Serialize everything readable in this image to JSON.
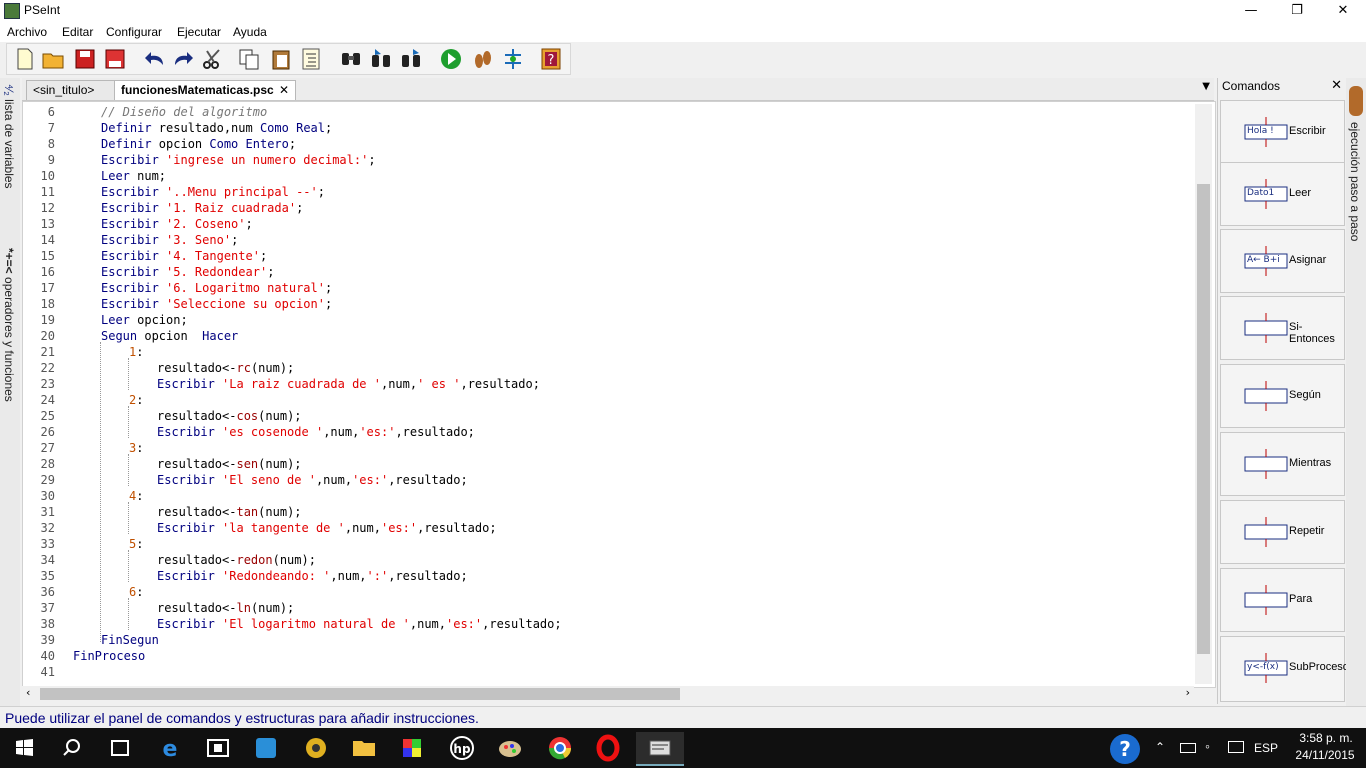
{
  "window": {
    "title": "PSeInt",
    "controls": [
      "minimize-icon",
      "maximize-icon",
      "close-icon"
    ]
  },
  "menu": [
    "Archivo",
    "Editar",
    "Configurar",
    "Ejecutar",
    "Ayuda"
  ],
  "toolbar": [
    "new-file-icon",
    "open-file-icon",
    "save-icon",
    "save-as-icon",
    "undo-icon",
    "redo-icon",
    "cut-icon",
    "copy-icon",
    "paste-icon",
    "indent-icon",
    "search-icon",
    "search-next-icon",
    "replace-icon",
    "run-icon",
    "step-icon",
    "flowchart-icon",
    "help-icon"
  ],
  "tabs": [
    {
      "label": "<sin_titulo>",
      "active": false
    },
    {
      "label": "funcionesMatematicas.psc",
      "active": true
    }
  ],
  "tab_close": "✕",
  "left_sidebar": {
    "variables_label": "lista de variables",
    "operators_label": "operadores y funciones"
  },
  "code_lines": [
    {
      "n": "6",
      "text": "// Diseño del algoritmo"
    },
    {
      "n": "7",
      "text": "Definir resultado,num Como Real;"
    },
    {
      "n": "8",
      "text": "Definir opcion Como Entero;"
    },
    {
      "n": "9",
      "text": "Escribir 'ingrese un numero decimal:';"
    },
    {
      "n": "10",
      "text": "Leer num;"
    },
    {
      "n": "11",
      "text": "Escribir '..Menu principal --';"
    },
    {
      "n": "12",
      "text": "Escribir '1. Raiz cuadrada';"
    },
    {
      "n": "13",
      "text": "Escribir '2. Coseno';"
    },
    {
      "n": "14",
      "text": "Escribir '3. Seno';"
    },
    {
      "n": "15",
      "text": "Escribir '4. Tangente';"
    },
    {
      "n": "16",
      "text": "Escribir '5. Redondear';"
    },
    {
      "n": "17",
      "text": "Escribir '6. Logaritmo natural';"
    },
    {
      "n": "18",
      "text": "Escribir 'Seleccione su opcion';"
    },
    {
      "n": "19",
      "text": "Leer opcion;"
    },
    {
      "n": "20",
      "text": "Segun opcion  Hacer"
    },
    {
      "n": "21",
      "text": "1:"
    },
    {
      "n": "22",
      "text": "resultado<-rc(num);"
    },
    {
      "n": "23",
      "text": "Escribir 'La raiz cuadrada de ',num,' es ',resultado;"
    },
    {
      "n": "24",
      "text": "2:"
    },
    {
      "n": "25",
      "text": "resultado<-cos(num);"
    },
    {
      "n": "26",
      "text": "Escribir 'es cosenode ',num,'es:',resultado;"
    },
    {
      "n": "27",
      "text": "3:"
    },
    {
      "n": "28",
      "text": "resultado<-sen(num);"
    },
    {
      "n": "29",
      "text": "Escribir 'El seno de ',num,'es:',resultado;"
    },
    {
      "n": "30",
      "text": "4:"
    },
    {
      "n": "31",
      "text": "resultado<-tan(num);"
    },
    {
      "n": "32",
      "text": "Escribir 'la tangente de ',num,'es:',resultado;"
    },
    {
      "n": "33",
      "text": "5:"
    },
    {
      "n": "34",
      "text": "resultado<-redon(num);"
    },
    {
      "n": "35",
      "text": "Escribir 'Redondeando: ',num,':',resultado;"
    },
    {
      "n": "36",
      "text": "6:"
    },
    {
      "n": "37",
      "text": "resultado<-ln(num);"
    },
    {
      "n": "38",
      "text": "Escribir 'El logaritmo natural de ',num,'es:',resultado;"
    },
    {
      "n": "39",
      "text": "FinSegun"
    },
    {
      "n": "40",
      "text": "FinProceso"
    },
    {
      "n": "41",
      "text": ""
    }
  ],
  "commands_panel": {
    "title": "Comandos",
    "close": "✕",
    "items": [
      {
        "label": "Escribir",
        "icon_text": "Hola !"
      },
      {
        "label": "Leer",
        "icon_text": "Dato1"
      },
      {
        "label": "Asignar",
        "icon_text": "A← B+i"
      },
      {
        "label": "Si-Entonces",
        "icon_text": ""
      },
      {
        "label": "Según",
        "icon_text": ""
      },
      {
        "label": "Mientras",
        "icon_text": ""
      },
      {
        "label": "Repetir",
        "icon_text": ""
      },
      {
        "label": "Para",
        "icon_text": ""
      },
      {
        "label": "SubProceso",
        "icon_text": "y<-f(x)"
      }
    ]
  },
  "right_sidebar": {
    "label": "ejecución paso a paso"
  },
  "statusbar": {
    "text": "Puede utilizar el panel de comandos y estructuras para añadir instrucciones."
  },
  "taskbar": {
    "time": "3:58 p. m.",
    "date": "24/11/2015",
    "language": "ESP",
    "apps": [
      "start-icon",
      "search-icon",
      "task-view-icon",
      "edge-icon",
      "store-icon",
      "app-icon",
      "app-icon",
      "file-explorer-icon",
      "app-icon",
      "hp-icon",
      "paint-icon",
      "chrome-icon",
      "opera-icon",
      "pseint-icon"
    ]
  },
  "colors": {
    "keyword": "#00007f",
    "string": "#e00000",
    "comment": "#777777",
    "statusbar_text": "#00007f"
  }
}
